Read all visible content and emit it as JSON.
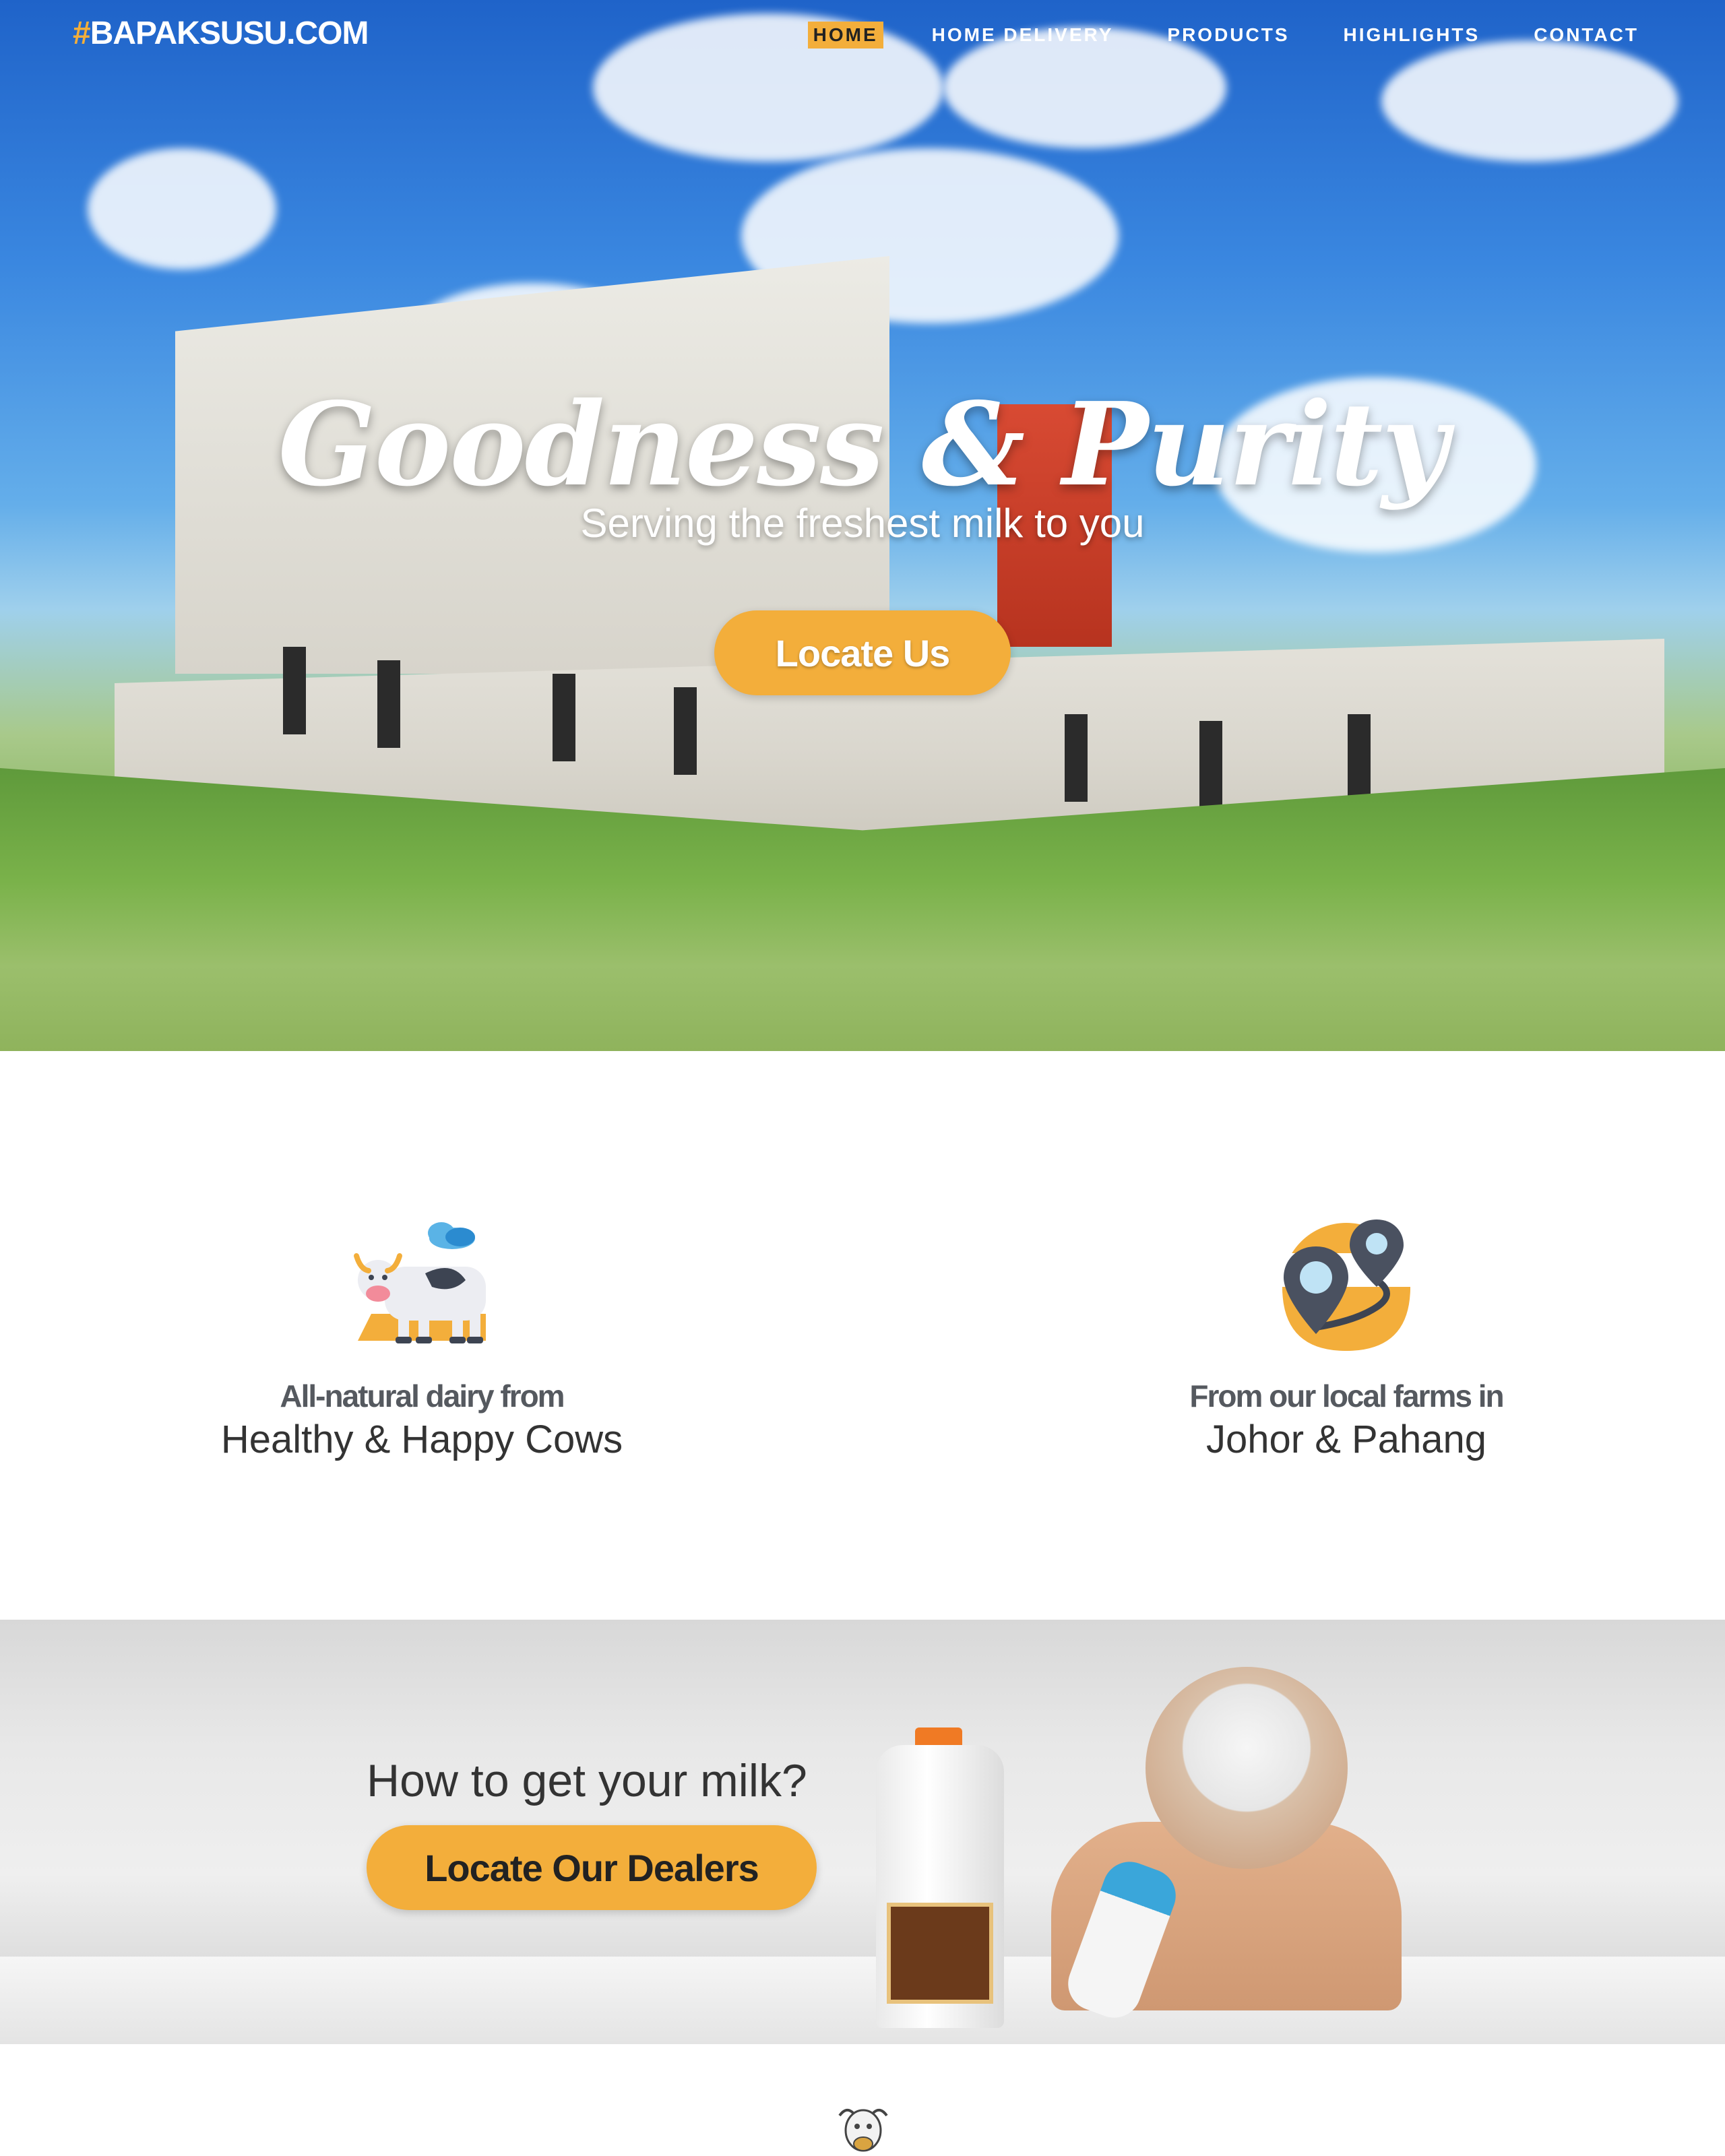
{
  "brand": {
    "hash": "#",
    "name": "BAPAKSUSU.COM"
  },
  "nav": {
    "items": [
      {
        "label": "HOME",
        "active": true
      },
      {
        "label": "HOME DELIVERY",
        "active": false
      },
      {
        "label": "PRODUCTS",
        "active": false
      },
      {
        "label": "HIGHLIGHTS",
        "active": false
      },
      {
        "label": "CONTACT",
        "active": false
      }
    ]
  },
  "hero": {
    "title": "Goodness & Purity",
    "subtitle": "Serving the freshest milk to you",
    "cta_label": "Locate Us"
  },
  "features": [
    {
      "icon": "cow-icon",
      "lead": "All-natural dairy from",
      "main": "Healthy & Happy Cows"
    },
    {
      "icon": "map-pin-icon",
      "lead": "From our local farms in",
      "main": "Johor & Pahang"
    }
  ],
  "milk_band": {
    "question": "How to get your milk?",
    "cta_label": "Locate Our Dealers"
  },
  "colors": {
    "accent": "#f3ae3b",
    "text_dark": "#333333",
    "text_muted": "#55595f"
  }
}
